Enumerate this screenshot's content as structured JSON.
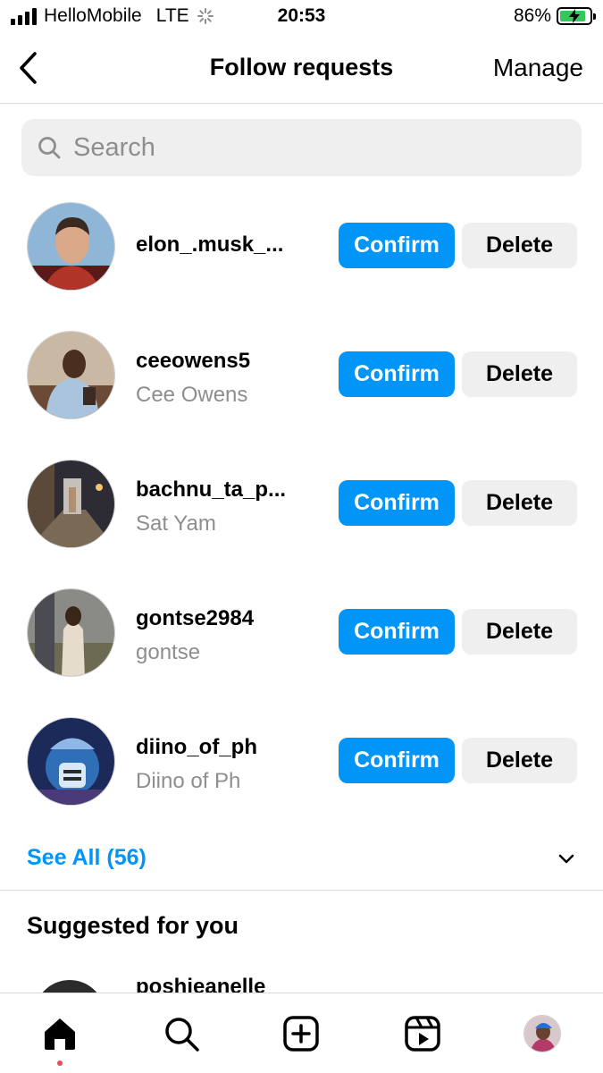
{
  "status_bar": {
    "carrier": "HelloMobile",
    "network": "LTE",
    "time": "20:53",
    "battery_percent": "86%",
    "battery_level": 0.86
  },
  "header": {
    "title": "Follow requests",
    "manage_label": "Manage"
  },
  "search": {
    "placeholder": "Search"
  },
  "requests": [
    {
      "username": "elon_.musk_...",
      "full_name": ""
    },
    {
      "username": "ceeowens5",
      "full_name": "Cee Owens"
    },
    {
      "username": "bachnu_ta_p...",
      "full_name": "Sat Yam"
    },
    {
      "username": "gontse2984",
      "full_name": "gontse"
    },
    {
      "username": "diino_of_ph",
      "full_name": "Diino of Ph"
    }
  ],
  "buttons": {
    "confirm_label": "Confirm",
    "delete_label": "Delete"
  },
  "see_all": {
    "label": "See All (56)"
  },
  "suggested": {
    "title": "Suggested for you",
    "items": [
      {
        "username": "poshieanelle"
      }
    ]
  },
  "tab_bar": {
    "icons": [
      "home-icon",
      "search-icon",
      "create-icon",
      "reels-icon",
      "profile-avatar"
    ]
  },
  "colors": {
    "accent": "#0095f6",
    "secondary_button": "#efefef",
    "muted_text": "#8e8e8e",
    "notification_dot": "#ed4956",
    "battery": "#34c759"
  }
}
